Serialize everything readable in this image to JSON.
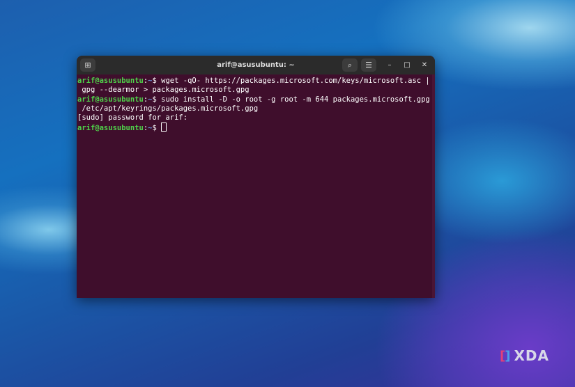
{
  "window": {
    "title": "arif@asusubuntu: ~"
  },
  "terminal": {
    "lines": [
      {
        "user": "arif@asusubuntu",
        "sep": ":",
        "path": "~",
        "prompt": "$ ",
        "text": "wget -qO- https://packages.microsoft.com/keys/microsoft.asc |"
      },
      {
        "text": " gpg --dearmor > packages.microsoft.gpg"
      },
      {
        "user": "arif@asusubuntu",
        "sep": ":",
        "path": "~",
        "prompt": "$ ",
        "text": "sudo install -D -o root -g root -m 644 packages.microsoft.gpg"
      },
      {
        "text": " /etc/apt/keyrings/packages.microsoft.gpg"
      },
      {
        "text": "[sudo] password for arif:"
      },
      {
        "user": "arif@asusubuntu",
        "sep": ":",
        "path": "~",
        "prompt": "$ ",
        "text": ""
      }
    ]
  },
  "watermark": {
    "text": "XDA"
  }
}
